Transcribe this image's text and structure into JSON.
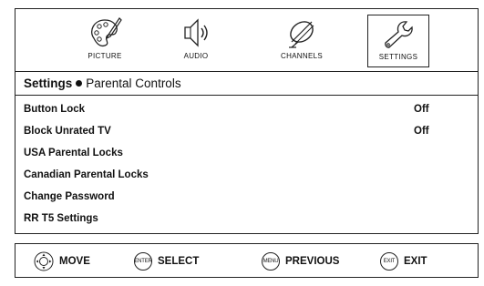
{
  "tabs": [
    {
      "label": "PICTURE",
      "icon": "palette-icon"
    },
    {
      "label": "AUDIO",
      "icon": "speaker-icon"
    },
    {
      "label": "CHANNELS",
      "icon": "satellite-dish-icon"
    },
    {
      "label": "SETTINGS",
      "icon": "wrench-icon"
    }
  ],
  "active_tab": "SETTINGS",
  "breadcrumb": {
    "parent": "Settings",
    "current": "Parental Controls"
  },
  "menu": [
    {
      "label": "Button Lock",
      "value": "Off"
    },
    {
      "label": "Block Unrated TV",
      "value": "Off"
    },
    {
      "label": "USA Parental Locks",
      "value": ""
    },
    {
      "label": "Canadian Parental Locks",
      "value": ""
    },
    {
      "label": "Change Password",
      "value": ""
    },
    {
      "label": "RR T5 Settings",
      "value": ""
    }
  ],
  "footer": [
    {
      "icon": "dpad-icon",
      "icon_text": "",
      "label": "MOVE"
    },
    {
      "icon": "enter-key-icon",
      "icon_text": "ENTER",
      "label": "SELECT"
    },
    {
      "icon": "menu-key-icon",
      "icon_text": "MENU",
      "label": "PREVIOUS"
    },
    {
      "icon": "exit-key-icon",
      "icon_text": "EXIT",
      "label": "EXIT"
    }
  ]
}
